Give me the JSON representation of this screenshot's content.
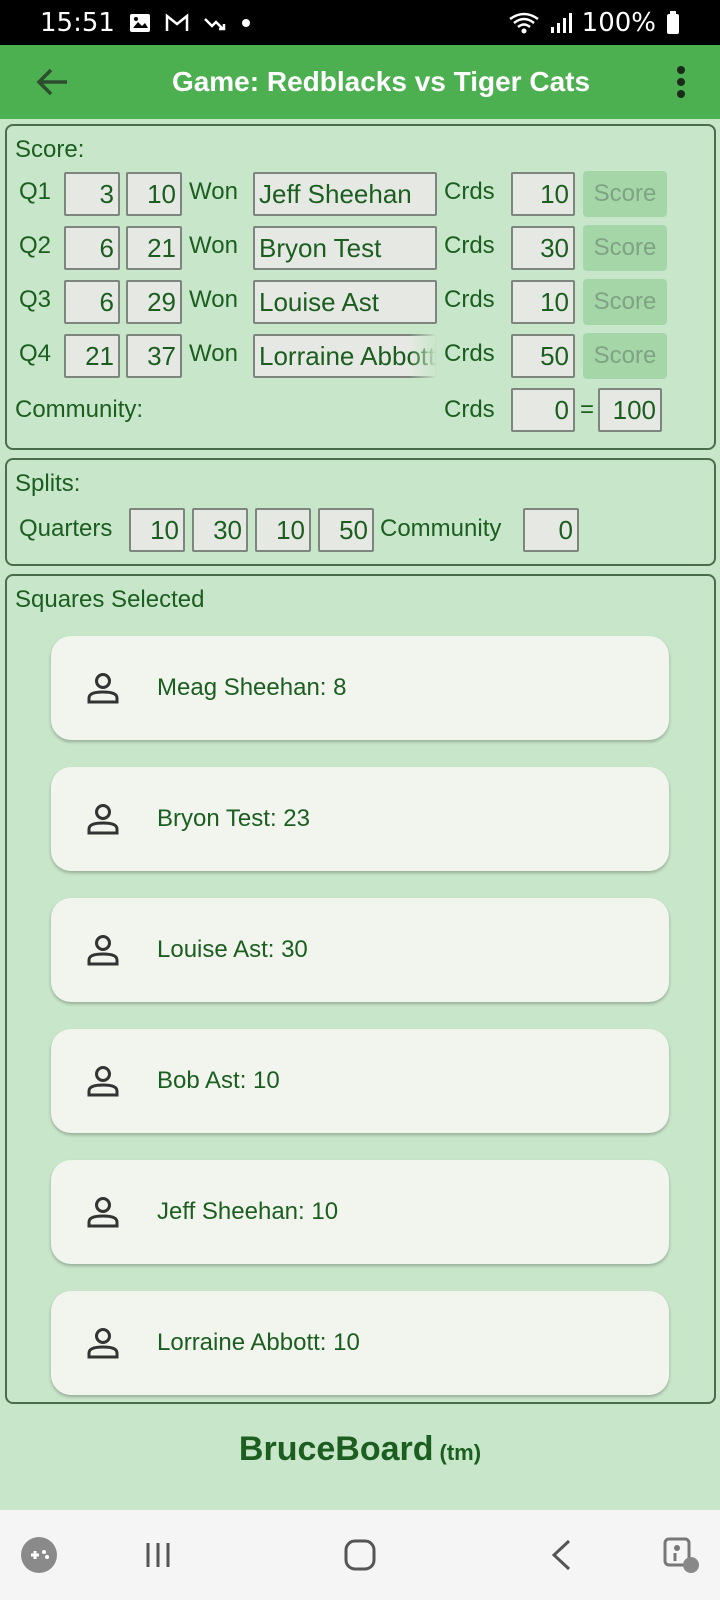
{
  "status": {
    "time": "15:51",
    "battery": "100%"
  },
  "appbar": {
    "title": "Game: Redblacks vs Tiger Cats"
  },
  "score": {
    "label": "Score:",
    "won_label": "Won",
    "crds_label": "Crds",
    "score_button": "Score",
    "quarters": [
      {
        "q": "Q1",
        "a": "3",
        "b": "10",
        "winner": "Jeff Sheehan",
        "crds": "10"
      },
      {
        "q": "Q2",
        "a": "6",
        "b": "21",
        "winner": "Bryon Test",
        "crds": "30"
      },
      {
        "q": "Q3",
        "a": "6",
        "b": "29",
        "winner": "Louise Ast",
        "crds": "10"
      },
      {
        "q": "Q4",
        "a": "21",
        "b": "37",
        "winner": "Lorraine Abbott",
        "crds": "50"
      }
    ],
    "community_label": "Community:",
    "community_crds": "0",
    "equals": "=",
    "total": "100"
  },
  "splits": {
    "label": "Splits:",
    "quarters_label": "Quarters",
    "values": [
      "10",
      "30",
      "10",
      "50"
    ],
    "community_label": "Community",
    "community_value": "0"
  },
  "squares": {
    "label": "Squares Selected",
    "items": [
      "Meag Sheehan: 8",
      "Bryon Test: 23",
      "Louise Ast: 30",
      "Bob Ast: 10",
      "Jeff Sheehan: 10",
      "Lorraine Abbott: 10"
    ]
  },
  "footer": {
    "brand": "BruceBoard",
    "tm": "(tm)"
  },
  "colors": {
    "appbar": "#4caf50",
    "background": "#c8e6c9",
    "text": "#1b5e20",
    "card": "#f1f5ee"
  },
  "icons": [
    "back-arrow-icon",
    "more-vert-icon",
    "person-icon",
    "game-icon",
    "recents-icon",
    "home-icon",
    "nav-back-icon",
    "accessibility-icon"
  ]
}
